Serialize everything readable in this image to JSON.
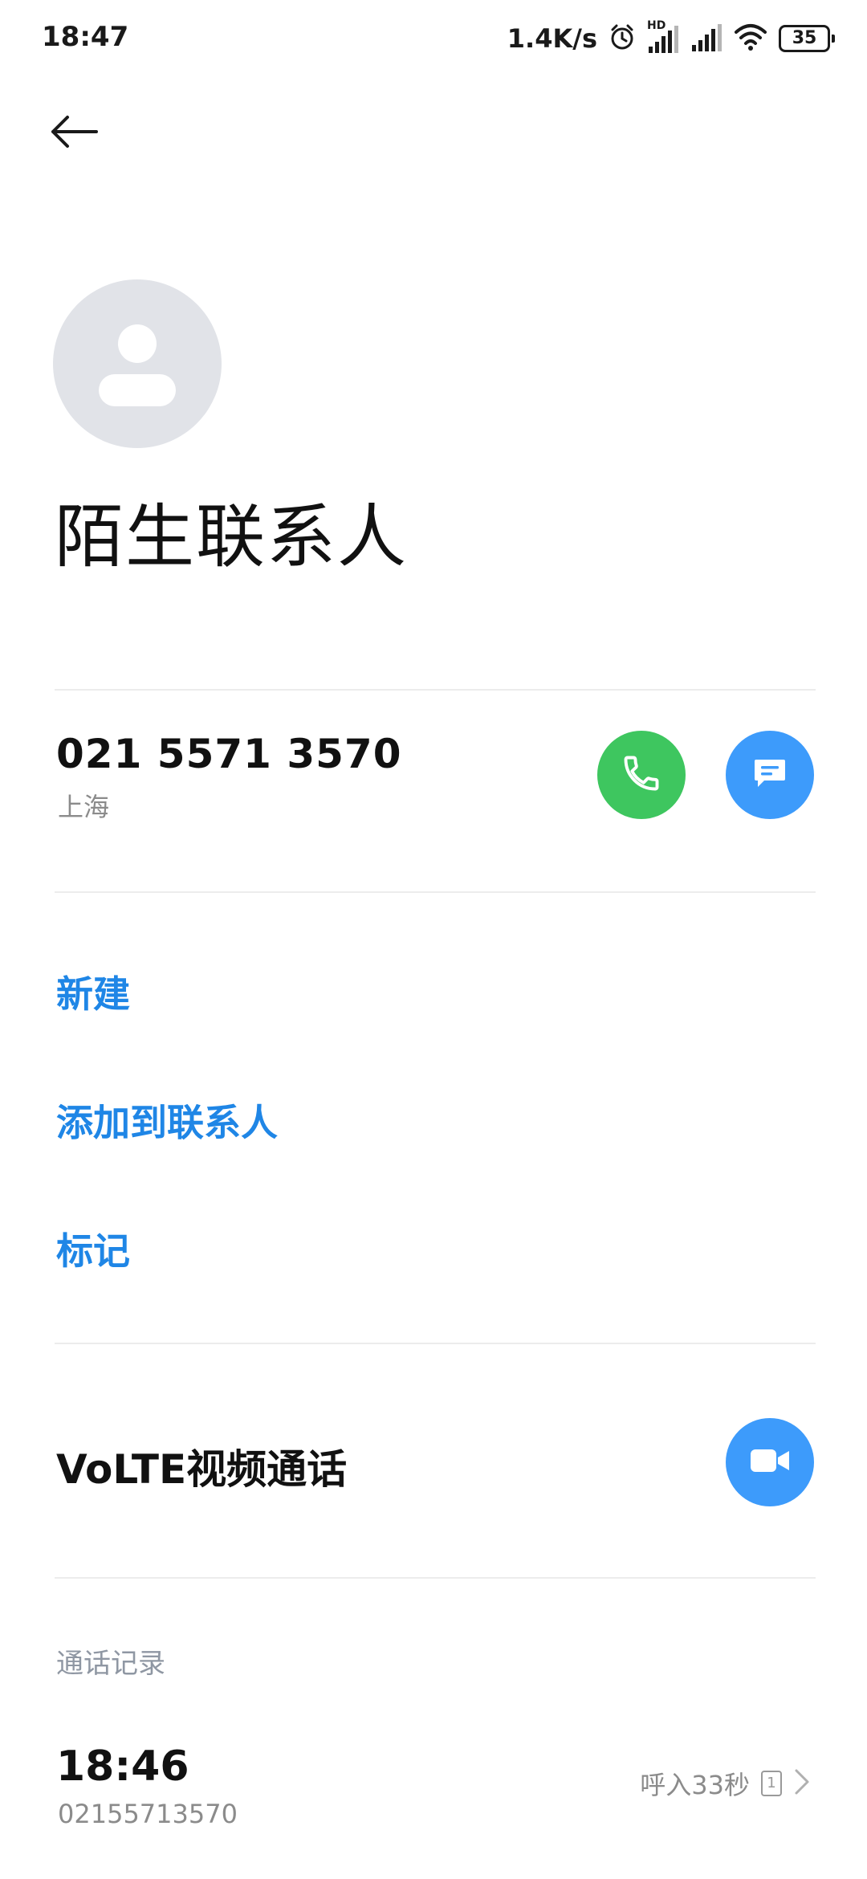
{
  "status_bar": {
    "time": "18:47",
    "net_speed": "1.4K/s",
    "network_label": "HD",
    "battery_level": "35"
  },
  "contact": {
    "name": "陌生联系人",
    "phone_number": "021 5571 3570",
    "location": "上海"
  },
  "actions": {
    "new_label": "新建",
    "add_to_contacts_label": "添加到联系人",
    "mark_label": "标记"
  },
  "video_call": {
    "label": "VoLTE视频通话"
  },
  "call_log": {
    "header": "通话记录",
    "entries": [
      {
        "time": "18:46",
        "number": "02155713570",
        "type": "呼入33秒",
        "sim": "1"
      }
    ]
  },
  "colors": {
    "accent_blue": "#1f86e6",
    "call_green": "#3ec65f",
    "button_blue": "#3d9bfb",
    "avatar_bg": "#e1e3e8"
  }
}
